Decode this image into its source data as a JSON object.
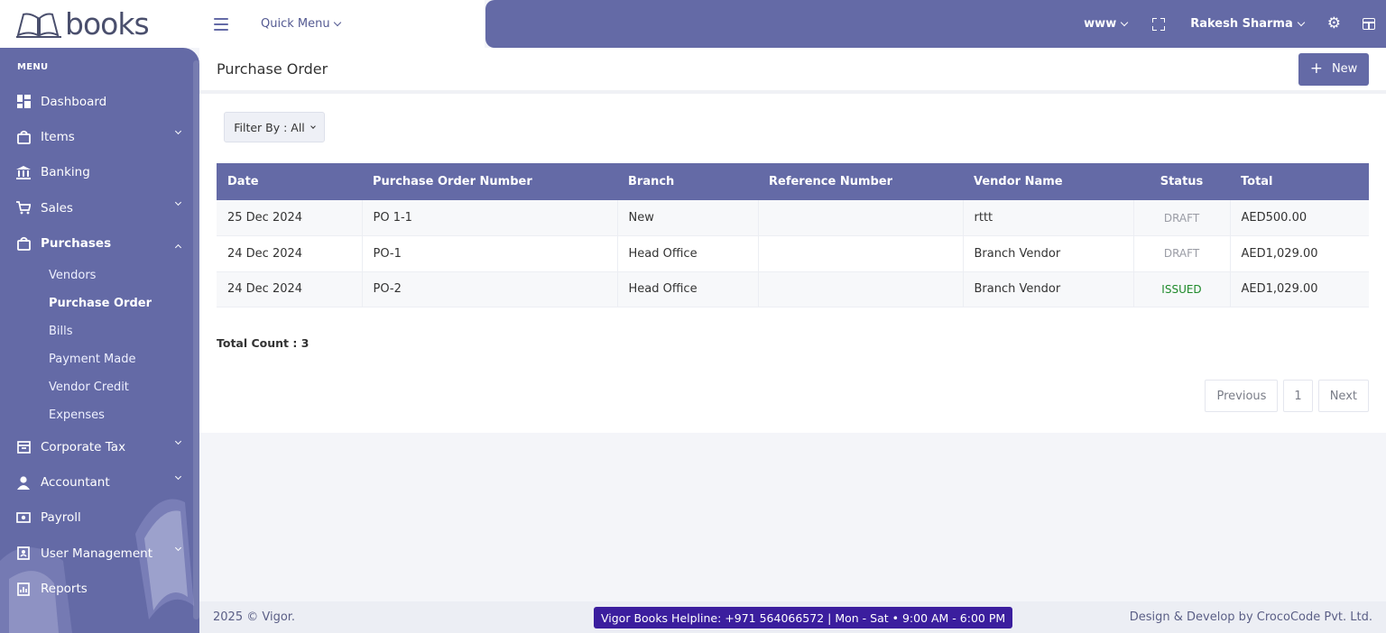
{
  "brand": {
    "logo_text": "books"
  },
  "topbar": {
    "quick_menu": "Quick Menu",
    "www": "www",
    "user": "Rakesh Sharma"
  },
  "sidebar": {
    "menu_label": "MENU",
    "items": [
      {
        "label": "Dashboard",
        "icon": "dashboard-icon"
      },
      {
        "label": "Items",
        "icon": "bag-icon"
      },
      {
        "label": "Banking",
        "icon": "bank-icon"
      },
      {
        "label": "Sales",
        "icon": "cart-icon"
      },
      {
        "label": "Purchases",
        "icon": "bag-icon"
      },
      {
        "label": "Corporate Tax",
        "icon": "archive-icon"
      },
      {
        "label": "Accountant",
        "icon": "user-icon"
      },
      {
        "label": "Payroll",
        "icon": "money-icon"
      },
      {
        "label": "User Management",
        "icon": "user-badge-icon"
      },
      {
        "label": "Reports",
        "icon": "report-icon"
      }
    ],
    "purchases_sub": [
      "Vendors",
      "Purchase Order",
      "Bills",
      "Payment Made",
      "Vendor Credit",
      "Expenses"
    ]
  },
  "page": {
    "title": "Purchase Order",
    "new_button": "New",
    "filter": "Filter By : All",
    "total_count": "Total Count : 3"
  },
  "table": {
    "headers": [
      "Date",
      "Purchase Order Number",
      "Branch",
      "Reference Number",
      "Vendor Name",
      "Status",
      "Total"
    ],
    "rows": [
      [
        "25 Dec 2024",
        "PO 1-1",
        "New",
        "",
        "rttt",
        "DRAFT",
        "AED500.00"
      ],
      [
        "24 Dec 2024",
        "PO-1",
        "Head Office",
        "",
        "Branch Vendor",
        "DRAFT",
        "AED1,029.00"
      ],
      [
        "24 Dec 2024",
        "PO-2",
        "Head Office",
        "",
        "Branch Vendor",
        "ISSUED",
        "AED1,029.00"
      ]
    ]
  },
  "pagination": {
    "previous": "Previous",
    "page": "1",
    "next": "Next"
  },
  "footer": {
    "copyright": "2025 © Vigor.",
    "helpline": "Vigor Books Helpline: +971 564066572 | Mon - Sat • 9:00 AM - 6:00 PM",
    "credit": "Design & Develop by CrocoCode Pvt. Ltd."
  },
  "colors": {
    "primary": "#646aa6",
    "issued": "#1e8a2a",
    "draft": "#9a9ca5",
    "helpline_bg": "#3b1e9e"
  }
}
